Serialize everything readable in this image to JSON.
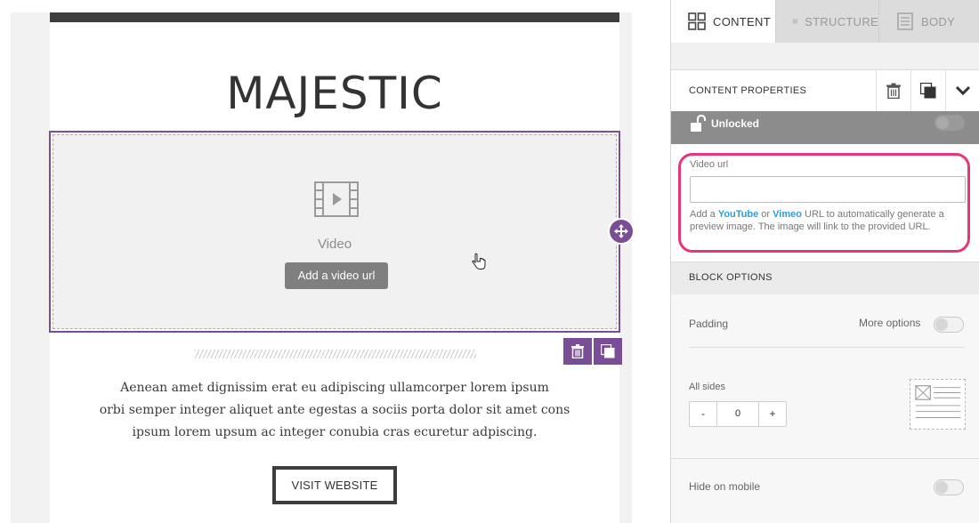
{
  "canvas": {
    "logo_text": "MAJESTIC",
    "video_block": {
      "label": "Video",
      "add_button": "Add a video url"
    },
    "body_lines": [
      "Aenean amet dignissim erat eu adipiscing ullamcorper lorem ipsum",
      "orbi semper integer aliquet ante egestas a sociis porta dolor sit amet cons",
      "ipsum lorem upsum ac integer conubia cras ecuretur adpiscing."
    ],
    "cta_label": "VISIT WEBSITE"
  },
  "sidebar": {
    "tabs": [
      {
        "label": "CONTENT",
        "active": true,
        "icon": "grid-icon"
      },
      {
        "label": "STRUCTURE",
        "active": false,
        "icon": "rows-icon"
      },
      {
        "label": "BODY",
        "active": false,
        "icon": "document-icon"
      }
    ],
    "content_properties": {
      "title": "CONTENT PROPERTIES",
      "actions": [
        "trash-icon",
        "duplicate-icon",
        "chevron-down-icon"
      ]
    },
    "lock": {
      "label": "Unlocked",
      "enabled": false
    },
    "video_url": {
      "label": "Video url",
      "value": "",
      "help_prefix": "Add a ",
      "help_youtube": "YouTube",
      "help_or": " or ",
      "help_vimeo": "Vimeo",
      "help_suffix": " URL to automatically generate a preview image. The image will link to the provided URL."
    },
    "block_options": {
      "title": "BLOCK OPTIONS",
      "padding_label": "Padding",
      "more_options_label": "More options",
      "more_options_enabled": false,
      "all_sides_label": "All sides",
      "stepper": {
        "minus": "-",
        "value": "0",
        "plus": "+"
      },
      "hide_on_mobile_label": "Hide on mobile",
      "hide_on_mobile_enabled": false
    }
  },
  "colors": {
    "accent_purple": "#7a4e96",
    "highlight_pink": "#e8357a",
    "link_blue": "#2a9fd8",
    "dark_bar": "#3d3d3d"
  }
}
